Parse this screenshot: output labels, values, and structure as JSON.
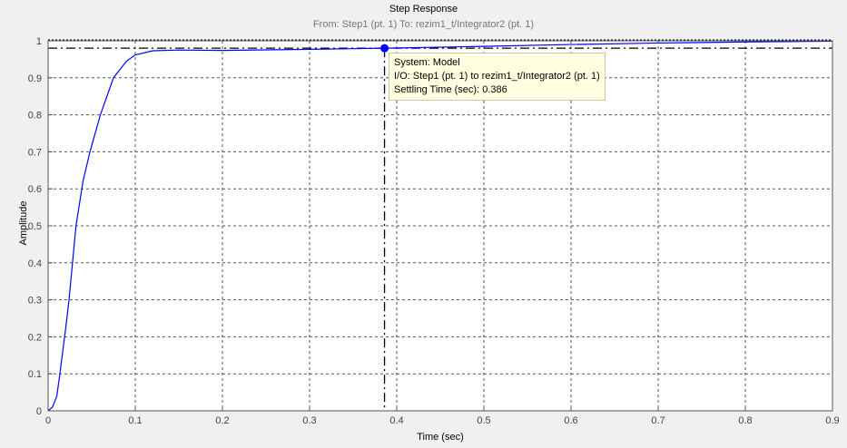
{
  "chart_data": {
    "type": "line",
    "title": "Step Response",
    "subtitle": "From: Step1 (pt. 1)  To: rezim1_t/Integrator2 (pt. 1)",
    "xlabel": "Time (sec)",
    "ylabel": "Amplitude",
    "xlim": [
      0,
      0.9
    ],
    "ylim": [
      0,
      1
    ],
    "xticks": [
      "0",
      "0.1",
      "0.2",
      "0.3",
      "0.4",
      "0.5",
      "0.6",
      "0.7",
      "0.8",
      "0.9"
    ],
    "yticks": [
      "0",
      "0.1",
      "0.2",
      "0.3",
      "0.4",
      "0.5",
      "0.6",
      "0.7",
      "0.8",
      "0.9",
      "1"
    ],
    "grid": true,
    "series": [
      {
        "name": "Model",
        "color": "#0000ff",
        "x": [
          0,
          0.005,
          0.01,
          0.0135,
          0.02,
          0.024,
          0.032,
          0.04,
          0.048,
          0.06,
          0.075,
          0.09,
          0.1,
          0.12,
          0.15,
          0.2,
          0.3,
          0.386,
          0.5,
          0.6,
          0.7,
          0.8,
          0.9
        ],
        "y": [
          0,
          0.01,
          0.04,
          0.1,
          0.22,
          0.3,
          0.5,
          0.62,
          0.7,
          0.8,
          0.9,
          0.945,
          0.962,
          0.973,
          0.975,
          0.974,
          0.977,
          0.98,
          0.985,
          0.99,
          0.994,
          0.997,
          0.999
        ]
      }
    ],
    "settling_band": 0.98,
    "marker": {
      "x": 0.386,
      "y": 0.98
    },
    "datatip": {
      "line1": "System: Model",
      "line2": "I/O: Step1 (pt. 1) to rezim1_t/Integrator2 (pt. 1)",
      "line3": "Settling Time (sec): 0.386"
    }
  }
}
